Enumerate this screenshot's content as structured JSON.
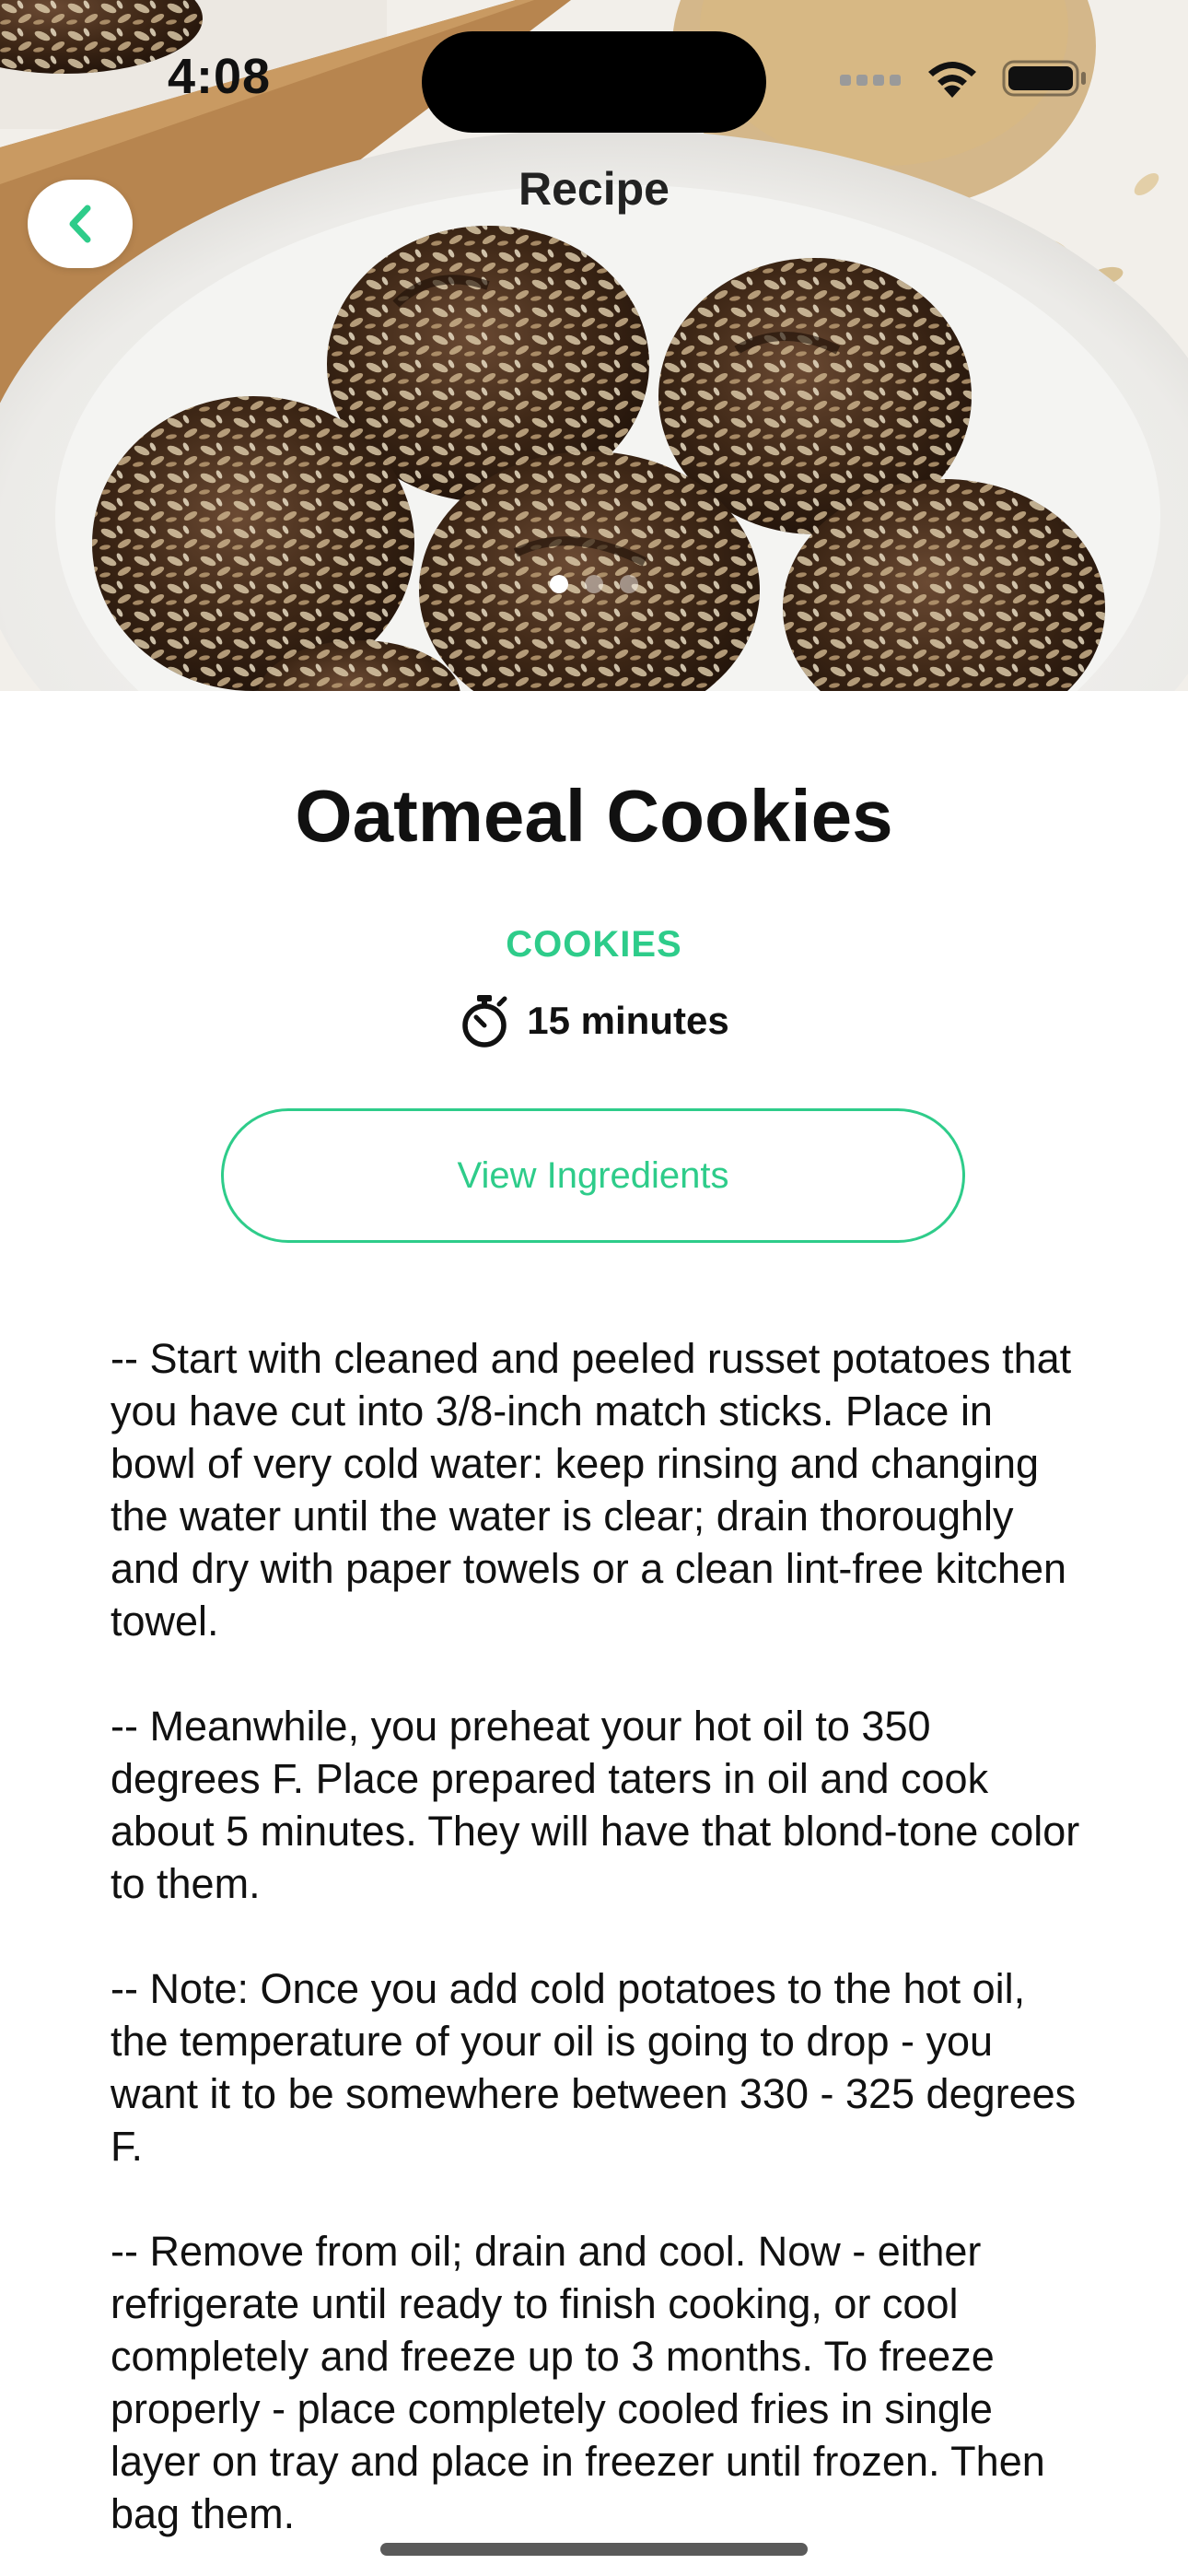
{
  "status_bar": {
    "time": "4:08"
  },
  "nav": {
    "title": "Recipe",
    "back_icon": "chevron-left-icon"
  },
  "hero": {
    "description_icon": "recipe-photo",
    "page_count": 3,
    "active_page": 1
  },
  "recipe": {
    "title": "Oatmeal Cookies",
    "category": "COOKIES",
    "time_icon": "stopwatch-icon",
    "time": "15 minutes",
    "ingredients_button": "View Ingredients",
    "instructions": [
      "-- Start with cleaned and peeled russet potatoes that you have cut into 3/8-inch match sticks. Place in bowl of very cold water: keep rinsing and changing the water until the water is clear; drain thoroughly and dry with paper towels or a clean lint-free kitchen towel.",
      " -- Meanwhile, you preheat your hot oil to 350 degrees F. Place prepared taters in oil and cook about 5 minutes. They will have that blond-tone color to them.",
      " -- Note: Once you add cold potatoes to the hot oil, the temperature of your oil is going to drop - you want it to be somewhere between 330 - 325 degrees F.",
      " -- Remove from oil; drain and cool. Now - either refrigerate until ready to finish cooking, or cool completely and freeze up to 3 months. To freeze properly - place completely cooled fries in single layer on tray and place in freezer until frozen. Then bag them."
    ]
  },
  "colors": {
    "accent": "#2ecc8a",
    "text": "#111111",
    "background": "#ffffff"
  }
}
